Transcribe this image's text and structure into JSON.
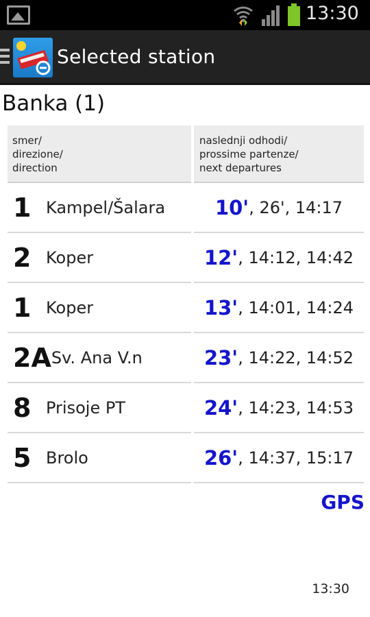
{
  "status_bar": {
    "time": "13:30",
    "icons": [
      "gallery-icon",
      "wifi-icon",
      "signal-icon",
      "battery-icon"
    ],
    "battery_color": "#7dc52a"
  },
  "action_bar": {
    "title": "Selected station",
    "icon": "bus-app-icon"
  },
  "station": {
    "name": "Banka (1)"
  },
  "table": {
    "header_direction": "smer/\ndirezione/\ndirection",
    "header_departures": "naslednji odhodi/\nprossime partenze/\nnext departures",
    "rows": [
      {
        "line": "1",
        "direction": "Kampel/Šalara",
        "first": "10'",
        "rest": ", 26', 14:17"
      },
      {
        "line": "2",
        "direction": "Koper",
        "first": "12'",
        "rest": ", 14:12, 14:42"
      },
      {
        "line": "1",
        "direction": "Koper",
        "first": "13'",
        "rest": ", 14:01, 14:24"
      },
      {
        "line": "2A",
        "direction": "Sv. Ana V.n",
        "first": "23'",
        "rest": ", 14:22, 14:52"
      },
      {
        "line": "8",
        "direction": "Prisoje PT",
        "first": "24'",
        "rest": ", 14:23, 14:53"
      },
      {
        "line": "5",
        "direction": "Brolo",
        "first": "26'",
        "rest": ", 14:37, 15:17"
      }
    ]
  },
  "gps_label": "GPS",
  "footer_time": "13:30",
  "colors": {
    "accent": "#1515cc",
    "action_bar": "#222222",
    "header_cell": "#ececec"
  }
}
